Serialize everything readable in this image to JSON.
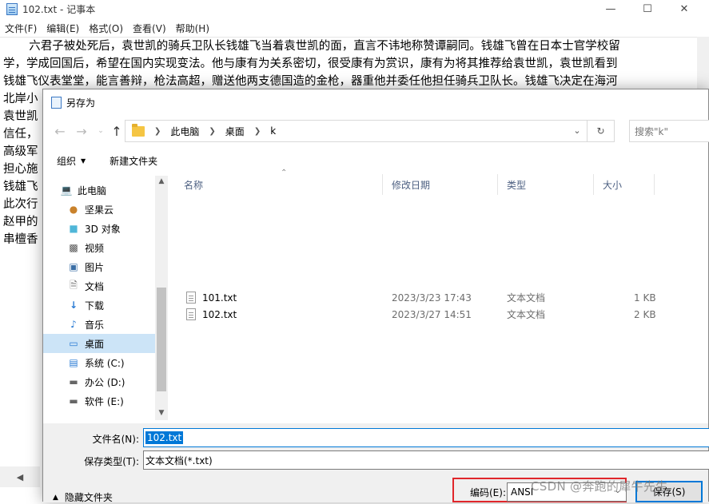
{
  "notepad": {
    "title": "102.txt - 记事本",
    "menu": [
      "文件(F)",
      "编辑(E)",
      "格式(O)",
      "查看(V)",
      "帮助(H)"
    ],
    "lines": [
      "       六君子被处死后，袁世凯的骑兵卫队长钱雄飞当着袁世凯的面，直言不讳地称赞谭嗣同。钱雄飞曾在日本士官学校留",
      "学，学成回国后，希望在国内实现变法。他与康有为关系密切，很受康有为赏识，康有为将其推荐给袁世凯，袁世凯看到",
      "钱雄飞仪表堂堂，能言善辩，枪法高超，赠送他两支德国造的金枪，器重他并委任他担任骑兵卫队长。钱雄飞决定在海河",
      "北岸小",
      "袁世凯",
      "信任，",
      "高级军",
      "担心施",
      "钱雄飞",
      "此次行",
      "赵甲的",
      "串檀香"
    ]
  },
  "dialog": {
    "title": "另存为",
    "breadcrumb": [
      "此电脑",
      "桌面",
      "k"
    ],
    "search_placeholder": "搜索\"k\"",
    "toolbar": {
      "organize": "组织",
      "new_folder": "新建文件夹"
    },
    "nav_items": [
      {
        "label": "此电脑",
        "icon": "computer-icon"
      },
      {
        "label": "坚果云",
        "icon": "nut-cloud-icon"
      },
      {
        "label": "3D 对象",
        "icon": "cube-icon"
      },
      {
        "label": "视频",
        "icon": "video-icon"
      },
      {
        "label": "图片",
        "icon": "picture-icon"
      },
      {
        "label": "文档",
        "icon": "document-icon"
      },
      {
        "label": "下载",
        "icon": "download-icon"
      },
      {
        "label": "音乐",
        "icon": "music-icon"
      },
      {
        "label": "桌面",
        "icon": "desktop-icon",
        "selected": true
      },
      {
        "label": "系统 (C:)",
        "icon": "system-drive-icon"
      },
      {
        "label": "办公 (D:)",
        "icon": "drive-icon"
      },
      {
        "label": "软件 (E:)",
        "icon": "drive-icon"
      }
    ],
    "columns": [
      "名称",
      "修改日期",
      "类型",
      "大小"
    ],
    "files": [
      {
        "name": "101.txt",
        "date": "2023/3/23 17:43",
        "type": "文本文档",
        "size": "1 KB"
      },
      {
        "name": "102.txt",
        "date": "2023/3/27 14:51",
        "type": "文本文档",
        "size": "2 KB"
      }
    ],
    "filename_label": "文件名(N):",
    "filename_value": "102.txt",
    "filetype_label": "保存类型(T):",
    "filetype_value": "文本文档(*.txt)",
    "hide_folders": "隐藏文件夹",
    "encoding_label": "编码(E):",
    "encoding_value": "ANSI",
    "save_button": "保存(S)"
  },
  "watermark": "CSDN @奔跑的犀牛先生"
}
